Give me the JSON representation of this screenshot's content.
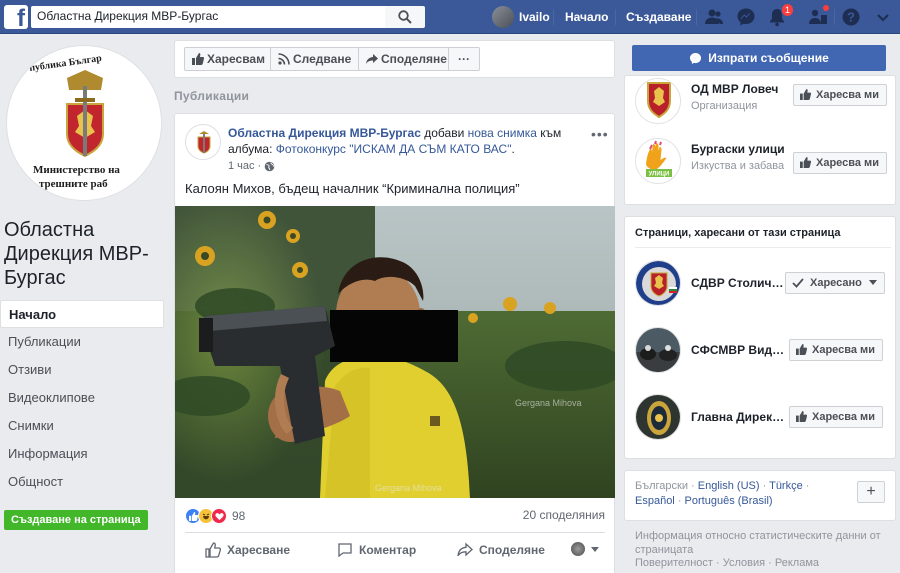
{
  "topbar": {
    "logo": "f",
    "search_value": "Областна Дирекция МВР-Бургас",
    "user_name": "Ivailo",
    "nav_home": "Начало",
    "nav_create": "Създаване",
    "notifications_count": "1",
    "bg_color": "#3b5998"
  },
  "left": {
    "seal_top_text": "публика Българ",
    "seal_bottom_text": "Министерство на",
    "seal_bottom_text2": "трешните раб",
    "page_name": "Областна Дирекция МВР-Бургас",
    "nav": [
      "Начало",
      "Публикации",
      "Отзиви",
      "Видеоклипове",
      "Снимки",
      "Информация",
      "Общност"
    ],
    "create_page": "Създаване на страница"
  },
  "actionbar": {
    "like": "Харесвам",
    "follow": "Следване",
    "share": "Споделяне",
    "more": "···"
  },
  "section_label": "Публикации",
  "post": {
    "author": "Областна Дирекция МВР-Бургас",
    "action": " добави ",
    "action_link": "нова снимка",
    "to_album": " към албума: ",
    "album": "Фотоконкурс \"ИСКАМ ДА СЪМ КАТО ВАС\"",
    "period": ".",
    "time": "1 час",
    "dot": "·",
    "text": "Калоян Михов, бъдещ началник “Криминална полиция”",
    "watermark": "Gergana Mihova",
    "reaction_count": "98",
    "shares": "20 споделяния",
    "actions": {
      "like": "Харесване",
      "comment": "Коментар",
      "share": "Споделяне"
    }
  },
  "right": {
    "message_button": "Изпрати съобщение",
    "related": [
      {
        "name": "ОД МВР Ловеч",
        "category": "Организация",
        "button": "Харесва ми"
      },
      {
        "name": "Бургаски улици",
        "category": "Изкуства и забава",
        "button": "Харесва ми"
      }
    ],
    "liked_title": "Страници, харесани от тази страница",
    "liked": [
      {
        "name": "СДВР Столич…",
        "button": "Харесано"
      },
      {
        "name": "СФСМВР Вид…",
        "button": "Харесва ми"
      },
      {
        "name": "Главна Дирек…",
        "button": "Харесва ми"
      }
    ],
    "languages": {
      "current": "Български",
      "sep": " · ",
      "others": [
        "English (US)",
        "Türkçe",
        "Español",
        "Português (Brasil)"
      ]
    },
    "plus": "+",
    "info": "Информация относно статистическите данни от страницата",
    "footer": [
      "Поверителност",
      "Условия",
      "Реклама"
    ]
  }
}
